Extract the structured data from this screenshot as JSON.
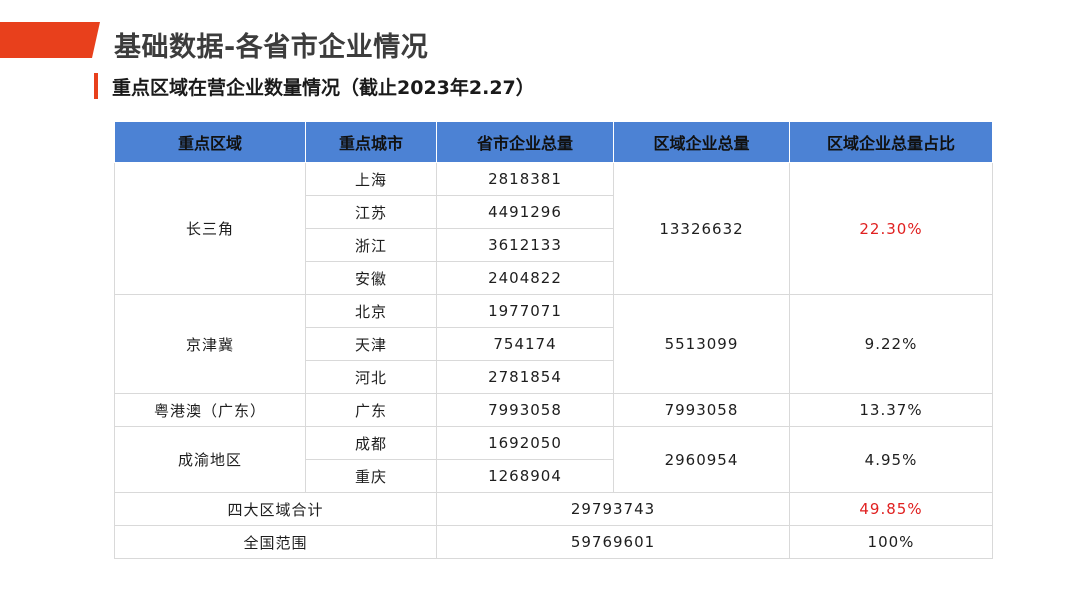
{
  "header": {
    "title": "基础数据-各省市企业情况",
    "subtitle": "重点区域在营企业数量情况（截止2023年2.27）"
  },
  "colors": {
    "accent": "#e8401c",
    "table_header": "#4c82d4",
    "highlight": "#e02020"
  },
  "table": {
    "columns": [
      "重点区域",
      "重点城市",
      "省市企业总量",
      "区域企业总量",
      "区域企业总量占比"
    ],
    "regions": [
      {
        "name": "长三角",
        "total": "13326632",
        "ratio": "22.30%",
        "cities": [
          {
            "city": "上海",
            "count": "2818381"
          },
          {
            "city": "江苏",
            "count": "4491296"
          },
          {
            "city": "浙江",
            "count": "3612133"
          },
          {
            "city": "安徽",
            "count": "2404822"
          }
        ]
      },
      {
        "name": "京津冀",
        "total": "5513099",
        "ratio": "9.22%",
        "cities": [
          {
            "city": "北京",
            "count": "1977071"
          },
          {
            "city": "天津",
            "count": "754174"
          },
          {
            "city": "河北",
            "count": "2781854"
          }
        ]
      },
      {
        "name": "粤港澳（广东）",
        "total": "7993058",
        "ratio": "13.37%",
        "cities": [
          {
            "city": "广东",
            "count": "7993058"
          }
        ]
      },
      {
        "name": "成渝地区",
        "total": "2960954",
        "ratio": "4.95%",
        "cities": [
          {
            "city": "成都",
            "count": "1692050"
          },
          {
            "city": "重庆",
            "count": "1268904"
          }
        ]
      }
    ],
    "summary": [
      {
        "label": "四大区域合计",
        "value": "29793743",
        "ratio": "49.85%"
      },
      {
        "label": "全国范围",
        "value": "59769601",
        "ratio": "100%"
      }
    ]
  }
}
